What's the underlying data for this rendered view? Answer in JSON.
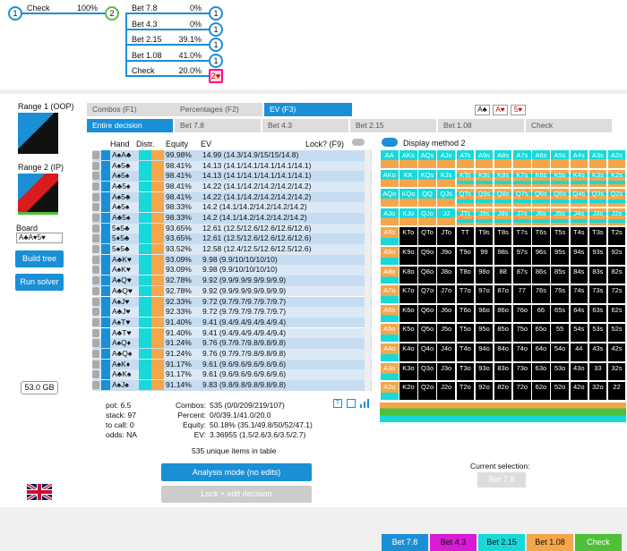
{
  "tree": {
    "root": "1",
    "check_label": "Check",
    "check_pct": "100%",
    "node2": "2",
    "bets": [
      {
        "label": "Bet 7.8",
        "pct": "0%",
        "node": "1"
      },
      {
        "label": "Bet 4.3",
        "pct": "0%",
        "node": "1"
      },
      {
        "label": "Bet 2.15",
        "pct": "39.1%",
        "node": "1"
      },
      {
        "label": "Bet 1.08",
        "pct": "41.0%",
        "node": "1"
      },
      {
        "label": "Check",
        "pct": "20.0%",
        "node": "2♥"
      }
    ]
  },
  "sidebar": {
    "range1": "Range 1 (OOP)",
    "range2": "Range 2 (IP)",
    "board": "Board",
    "board_cards": "A♣A♥5♥",
    "build": "Build tree",
    "run": "Run solver",
    "memory": "53.0 GB"
  },
  "tabs": {
    "top": [
      "Combos (F1)",
      "Percentages (F2)",
      "EV (F3)"
    ],
    "cards": [
      "A♣",
      "A♥",
      "5♥"
    ],
    "sub": [
      "Entire decision",
      "Bet 7.8",
      "Bet 4.3",
      "Bet 2.15",
      "Bet 1.08",
      "Check"
    ]
  },
  "table": {
    "h_hand": "Hand",
    "h_distr": "Distr.",
    "h_equity": "Equity",
    "h_ev": "EV",
    "h_lock": "Lock? (F9)",
    "rows": [
      [
        "A♠A♣",
        "99.98%",
        "14.99 (14.3/14.9/15/15/14.8)"
      ],
      [
        "A♠5♣",
        "98.41%",
        "14.13 (14.1/14.1/14.1/14.1/14.1)"
      ],
      [
        "A♠5♠",
        "98.41%",
        "14.13 (14.1/14.1/14.1/14.1/14.1)"
      ],
      [
        "A♣5♠",
        "98.41%",
        "14.22 (14.1/14.2/14.2/14.2/14.2)"
      ],
      [
        "A♠5♣",
        "98.41%",
        "14.22 (14.1/14.2/14.2/14.2/14.2)"
      ],
      [
        "A♠5♠",
        "98.33%",
        "14.2 (14.1/14.2/14.2/14.2/14.2)"
      ],
      [
        "A♣5♠",
        "98.33%",
        "14.2 (14.1/14.2/14.2/14.2/14.2)"
      ],
      [
        "5♠5♣",
        "93.65%",
        "12.61 (12.5/12.6/12.6/12.6/12.6)"
      ],
      [
        "5♦5♣",
        "93.65%",
        "12.61 (12.5/12.6/12.6/12.6/12.6)"
      ],
      [
        "5♠5♣",
        "93.52%",
        "12.58 (12.4/12.5/12.6/12.5/12.6)"
      ],
      [
        "A♣K♥",
        "93.09%",
        "9.98 (9.9/10/10/10/10)"
      ],
      [
        "A♠K♥",
        "93.09%",
        "9.98 (9.9/10/10/10/10)"
      ],
      [
        "A♠Q♥",
        "92.78%",
        "9.92 (9.9/9.9/9.9/9.9/9.9)"
      ],
      [
        "A♣Q♥",
        "92.78%",
        "9.92 (9.9/9.9/9.9/9.9/9.9)"
      ],
      [
        "A♠J♥",
        "92.33%",
        "9.72 (9.7/9.7/9.7/9.7/9.7)"
      ],
      [
        "A♣J♥",
        "92.33%",
        "9.72 (9.7/9.7/9.7/9.7/9.7)"
      ],
      [
        "A♠T♥",
        "91.40%",
        "9.41 (9.4/9.4/9.4/9.4/9.4)"
      ],
      [
        "A♣T♥",
        "91.40%",
        "9.41 (9.4/9.4/9.4/9.4/9.4)"
      ],
      [
        "A♠Q♦",
        "91.24%",
        "9.76 (9.7/9.7/9.8/9.8/9.8)"
      ],
      [
        "A♣Q♠",
        "91.24%",
        "9.76 (9.7/9.7/9.8/9.8/9.8)"
      ],
      [
        "A♠K♦",
        "91.17%",
        "9.61 (9.6/9.6/9.6/9.6/9.6)"
      ],
      [
        "A♣K♠",
        "91.17%",
        "9.61 (9.6/9.6/9.6/9.6/9.6)"
      ],
      [
        "A♠J♠",
        "91.14%",
        "9.83 (9.8/9.8/9.8/9.8/9.8)"
      ]
    ]
  },
  "stats": {
    "pot": "pot: 6.5",
    "stack": "stack: 97",
    "tocall": "to call: 0",
    "odds": "odds: NA",
    "combos_l": "Combos:",
    "combos_v": "535 (0/0/209/219/107)",
    "percent_l": "Percent:",
    "percent_v": "0/0/39.1/41.0/20.0",
    "equity_l": "Equity:",
    "equity_v": "50.18% (35.1/49.8/50/52/47.1)",
    "ev_l": "EV:",
    "ev_v": "3.36955 (1.5/2.6/3.6/3.5/2.7)",
    "unique": "535 unique items in table"
  },
  "buttons": {
    "analysis": "Analysis mode (no edits)",
    "lock": "Lock + edit decision"
  },
  "matrix": {
    "display_method": "Display method 2",
    "ranks": [
      "A",
      "K",
      "Q",
      "J",
      "T",
      "9",
      "8",
      "7",
      "6",
      "5",
      "4",
      "3",
      "2"
    ],
    "black": [
      [
        0,
        9,
        0
      ],
      [
        0,
        10,
        0
      ],
      [
        0,
        11,
        0
      ],
      [
        0,
        12,
        0
      ]
    ]
  },
  "actions": [
    {
      "label": "Bet 7.8",
      "color": "#1b8fd6"
    },
    {
      "label": "Bet 4.3",
      "color": "#d91bd6"
    },
    {
      "label": "Bet 2.15",
      "color": "#17d9d9"
    },
    {
      "label": "Bet 1.08",
      "color": "#f5a64a"
    },
    {
      "label": "Check",
      "color": "#4fbf3a"
    }
  ],
  "current_selection_label": "Current selection:",
  "current_selection": "Bet 7.8"
}
